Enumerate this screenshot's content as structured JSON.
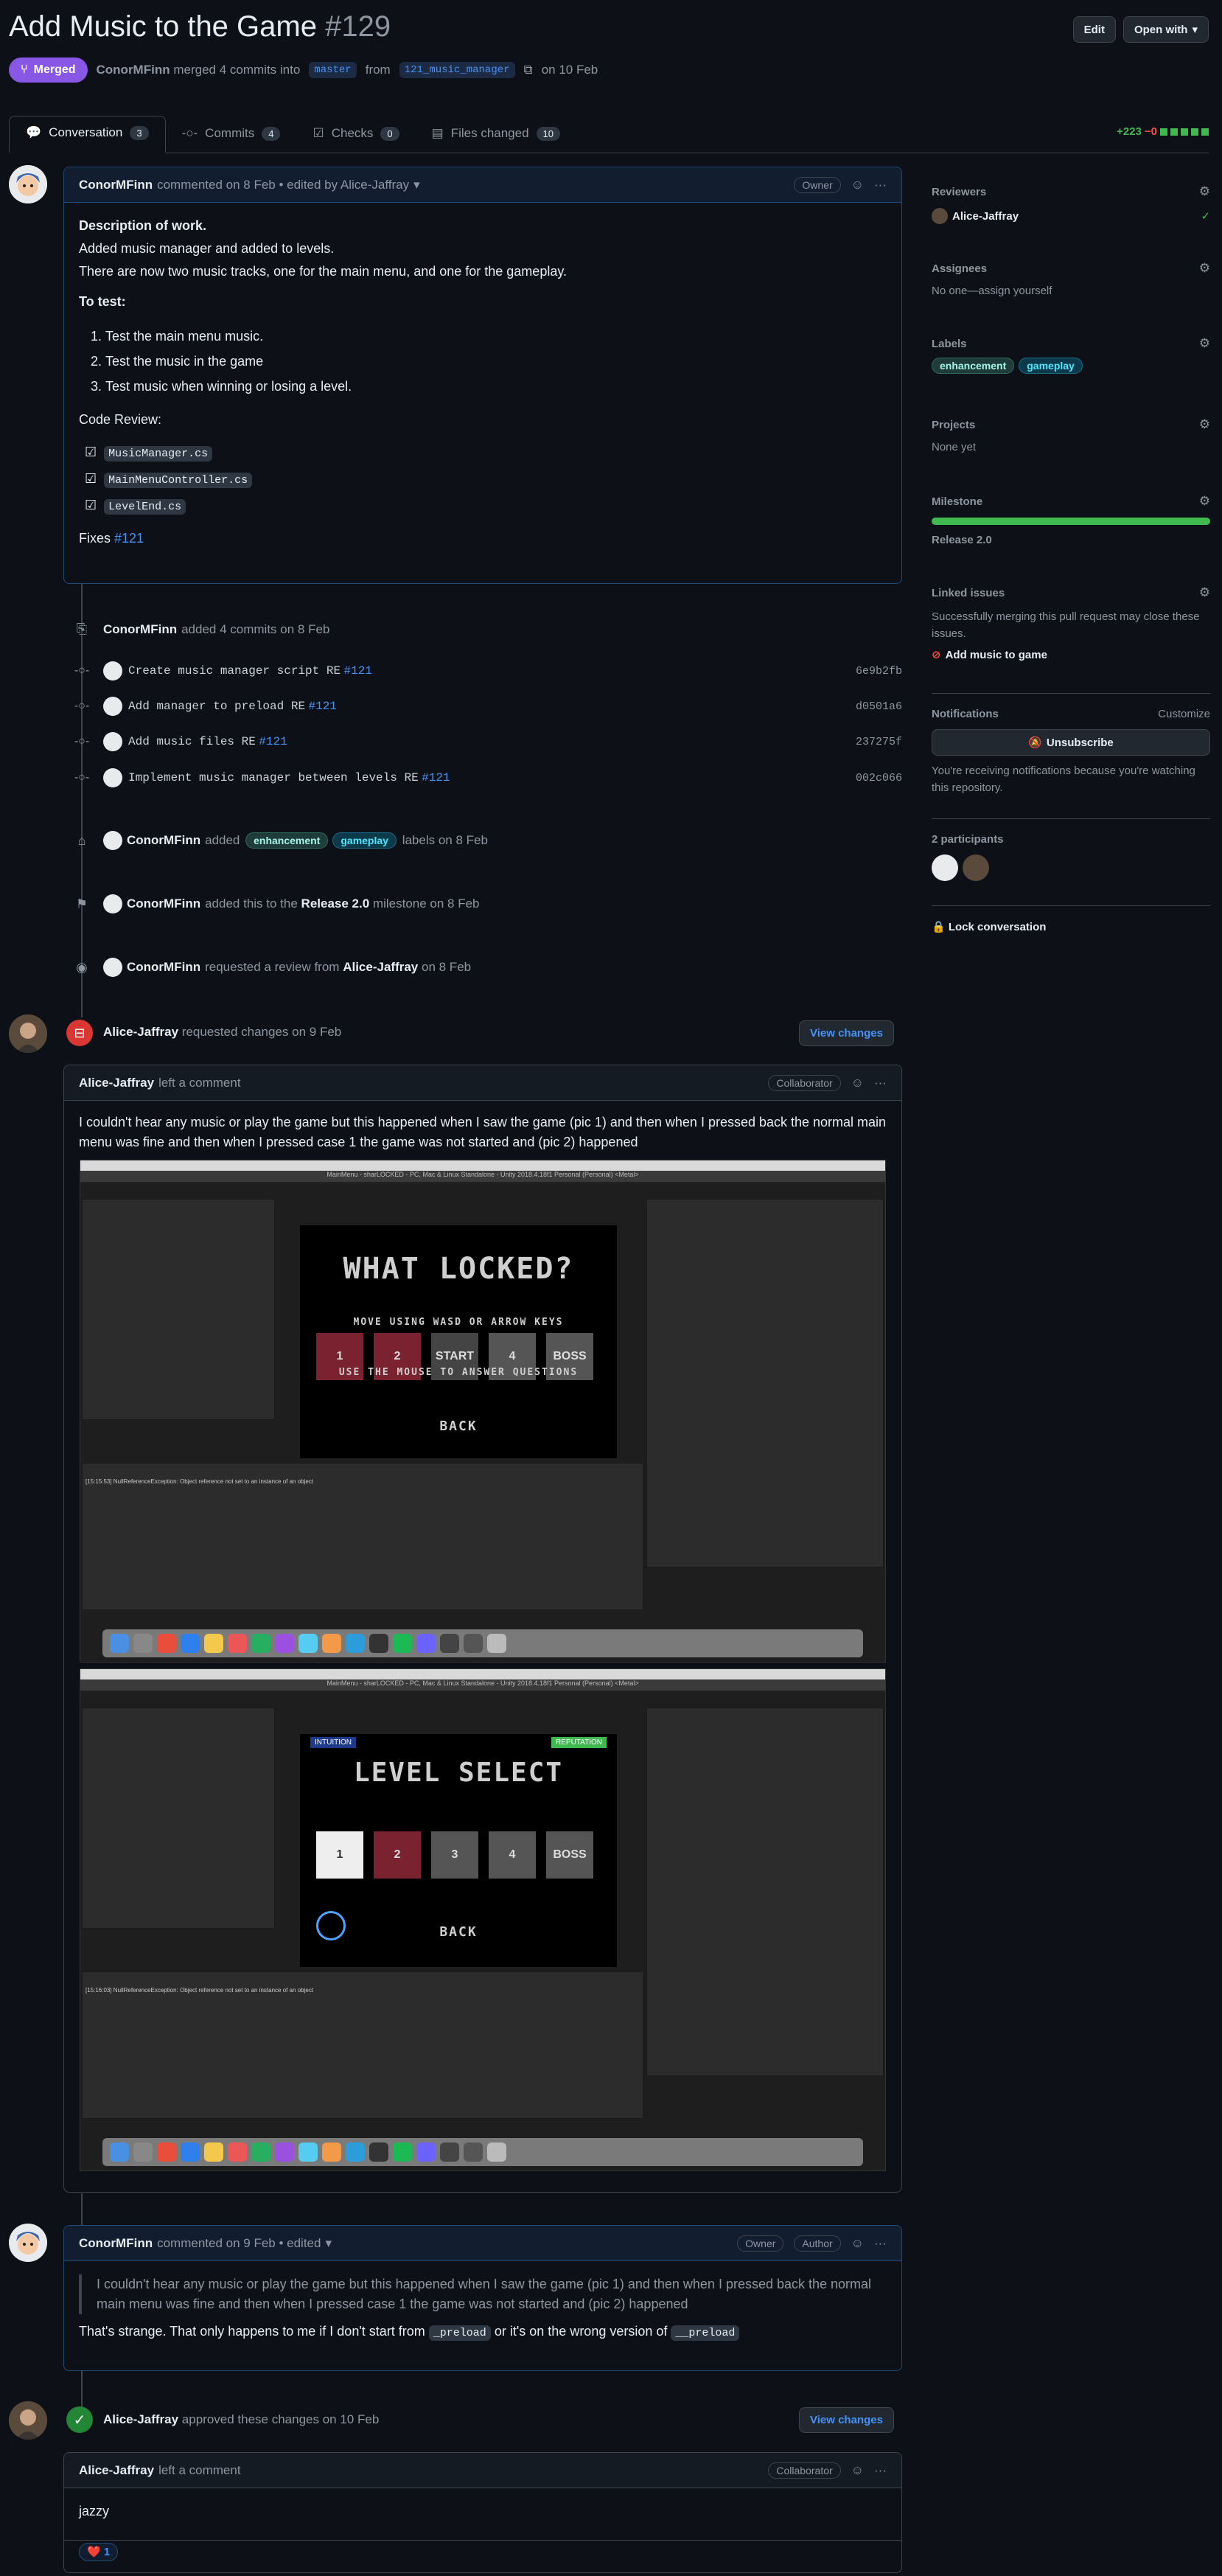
{
  "header": {
    "title": "Add Music to the Game",
    "number": "#129",
    "edit_label": "Edit",
    "open_with_label": "Open with",
    "status": "Merged",
    "author": "ConorMFinn",
    "merged_text": "merged 4 commits into",
    "base_branch": "master",
    "from_text": "from",
    "head_branch": "121_music_manager",
    "date_text": "on 10 Feb"
  },
  "tabs": [
    {
      "label": "Conversation",
      "count": "3"
    },
    {
      "label": "Commits",
      "count": "4"
    },
    {
      "label": "Checks",
      "count": "0"
    },
    {
      "label": "Files changed",
      "count": "10"
    }
  ],
  "diffstat": {
    "additions": "+223",
    "deletions": "−0"
  },
  "comment1": {
    "author": "ConorMFinn",
    "meta": "commented on 8 Feb • edited by Alice-Jaffray",
    "role": "Owner",
    "heading": "Description of work.",
    "line1": "Added music manager and added to levels.",
    "line2": "There are now two music tracks, one for the main menu, and one for the gameplay.",
    "to_test": "To test:",
    "tests": [
      "Test the main menu music.",
      "Test the music in the game",
      "Test music when winning or losing a level."
    ],
    "code_review": "Code Review:",
    "files": [
      "MusicManager.cs",
      "MainMenuController.cs",
      "LevelEnd.cs"
    ],
    "fixes_label": "Fixes",
    "fixes_ref": "#121"
  },
  "commits_event": {
    "author": "ConorMFinn",
    "text": "added 4 commits on 8 Feb"
  },
  "commits": [
    {
      "msg": "Create music manager script RE",
      "ref": "#121",
      "sha": "6e9b2fb"
    },
    {
      "msg": "Add manager to preload RE",
      "ref": "#121",
      "sha": "d0501a6"
    },
    {
      "msg": "Add music files RE",
      "ref": "#121",
      "sha": "237275f"
    },
    {
      "msg": "Implement music manager between levels RE",
      "ref": "#121",
      "sha": "002c066"
    }
  ],
  "labels_event": {
    "author": "ConorMFinn",
    "pre": "added",
    "label1": "enhancement",
    "label2": "gameplay",
    "post": "labels on 8 Feb"
  },
  "milestone_event": {
    "author": "ConorMFinn",
    "pre": "added this to the",
    "milestone": "Release 2.0",
    "post": "milestone on 8 Feb"
  },
  "review_req_event": {
    "author": "ConorMFinn",
    "pre": "requested a review from",
    "reviewer": "Alice-Jaffray",
    "post": "on 8 Feb"
  },
  "changes_req": {
    "author": "Alice-Jaffray",
    "text": "requested changes on 9 Feb",
    "button": "View changes"
  },
  "comment2": {
    "author": "Alice-Jaffray",
    "meta": "left a comment",
    "role": "Collaborator",
    "body": "I couldn't hear any music or play the game but this happened when I saw the game (pic 1) and then when I pressed back the normal main menu was fine and then when I pressed case 1 the game was not started and (pic 2) happened"
  },
  "shot1": {
    "window_title": "MainMenu - sharLOCKED - PC, Mac & Linux Standalone - Unity 2018.4.18f1 Personal (Personal) <Metal>",
    "game_title": "WHAT LOCKED?",
    "hint1": "MOVE USING WASD OR ARROW KEYS",
    "hint2": "USE THE MOUSE TO ANSWER QUESTIONS",
    "back": "BACK",
    "levels": [
      "1",
      "2",
      "START",
      "4",
      "BOSS"
    ],
    "console_err": "[15:15:53] NullReferenceException: Object reference not set to an instance of an object"
  },
  "shot2": {
    "window_title": "MainMenu - sharLOCKED - PC, Mac & Linux Standalone - Unity 2018.4.18f1 Personal (Personal) <Metal>",
    "intuition": "INTUITION",
    "reputation": "REPUTATION",
    "game_title": "LEVEL SELECT",
    "levels": [
      "1",
      "2",
      "3",
      "4",
      "BOSS"
    ],
    "back": "BACK",
    "console_err": "[15:16:03] NullReferenceException: Object reference not set to an instance of an object"
  },
  "comment3": {
    "author": "ConorMFinn",
    "meta": "commented on 9 Feb • edited",
    "role1": "Owner",
    "role2": "Author",
    "quote": "I couldn't hear any music or play the game but this happened when I saw the game (pic 1) and then when I pressed back the normal main menu was fine and then when I pressed case 1 the game was not started and (pic 2) happened",
    "reply_pre": "That's strange. That only happens to me if I don't start from",
    "code1": "_preload",
    "reply_mid": "or it's on the wrong version of",
    "code2": "__preload"
  },
  "approved": {
    "author": "Alice-Jaffray",
    "text": "approved these changes on 10 Feb",
    "button": "View changes"
  },
  "comment4": {
    "author": "Alice-Jaffray",
    "meta": "left a comment",
    "role": "Collaborator",
    "body": "jazzy",
    "reaction": "1"
  },
  "sidebar": {
    "reviewers_title": "Reviewers",
    "reviewer": "Alice-Jaffray",
    "assignees_title": "Assignees",
    "assignees_val": "No one—assign yourself",
    "labels_title": "Labels",
    "label1": "enhancement",
    "label2": "gameplay",
    "projects_title": "Projects",
    "projects_val": "None yet",
    "milestone_title": "Milestone",
    "milestone_progress": 1.0,
    "milestone_val": "Release 2.0",
    "linked_title": "Linked issues",
    "linked_desc": "Successfully merging this pull request may close these issues.",
    "linked_issue": "Add music to game",
    "notif_title": "Notifications",
    "customize": "Customize",
    "unsubscribe": "Unsubscribe",
    "notif_desc": "You're receiving notifications because you're watching this repository.",
    "participants": "2 participants",
    "lock": "Lock conversation"
  },
  "colors": {
    "merged": "#8957e5",
    "link": "#4493f8",
    "green": "#3fb950",
    "red": "#da3633"
  }
}
